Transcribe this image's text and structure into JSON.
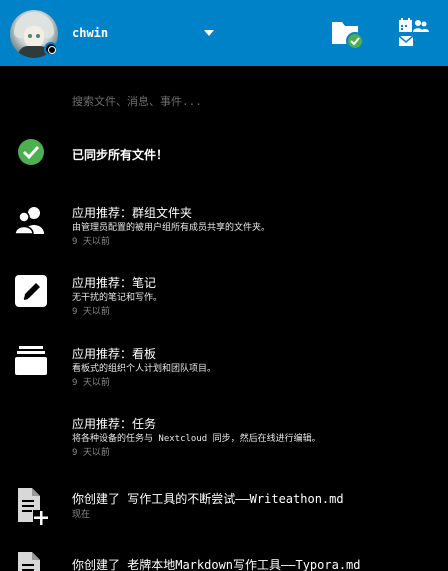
{
  "header": {
    "username": "chwin",
    "avatar_icon": "user-avatar",
    "status_icon": "online-status-icon",
    "dropdown_icon": "chevron-down-icon",
    "sync_icon": "folder-synced-icon",
    "apps_icon": "calendar-contacts-mail-icon",
    "accent_color": "#0082c9"
  },
  "search": {
    "placeholder": "搜索文件、消息、事件..."
  },
  "sync_status": {
    "text": "已同步所有文件！",
    "icon": "check-circle-icon",
    "color": "#4caf50"
  },
  "activities": [
    {
      "icon": "group-icon",
      "title": "应用推荐：群组文件夹",
      "desc": "由管理员配置的被用户组所有成员共享的文件夹。",
      "time": "9 天以前"
    },
    {
      "icon": "notes-edit-icon",
      "title": "应用推荐：笔记",
      "desc": "无干扰的笔记和写作。",
      "time": "9 天以前"
    },
    {
      "icon": "deck-icon",
      "title": "应用推荐：看板",
      "desc": "看板式的组织个人计划和团队项目。",
      "time": "9 天以前"
    },
    {
      "icon": "",
      "title": "应用推荐：任务",
      "desc": "将各种设备的任务与 Nextcloud 同步，然后在线进行编辑。",
      "time": "9 天以前"
    },
    {
      "icon": "file-add-icon",
      "title": "你创建了 写作工具的不断尝试——Writeathon.md",
      "desc": "",
      "time": "现在"
    },
    {
      "icon": "file-add-icon",
      "title": "你创建了 老牌本地Markdown写作工具——Typora.md",
      "desc": "",
      "time": ""
    }
  ]
}
